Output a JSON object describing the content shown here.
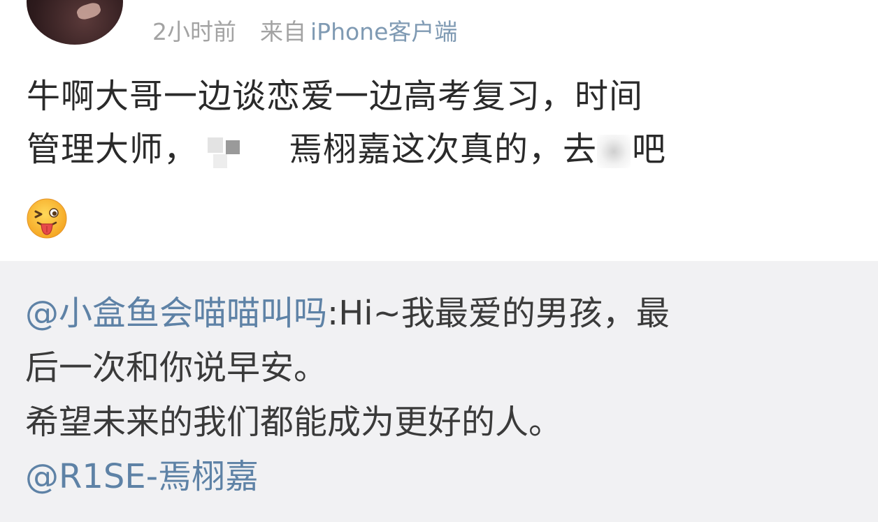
{
  "header": {
    "time": "2小时前",
    "source_prefix": "来自",
    "source_app": "iPhone客户端"
  },
  "post": {
    "line1": "牛啊大哥一边谈恋爱一边高考复习，时间",
    "line2_a": "管理大师，",
    "line2_b": "焉栩嘉这次真的，去",
    "line2_c": "吧",
    "emoji": "tongue-out-wink-emoji"
  },
  "quote": {
    "mention1": "@小盒鱼会喵喵叫吗",
    "line1_rest": ":Hi~我最爱的男孩，最",
    "line2": "后一次和你说早安。",
    "line3": "希望未来的我们都能成为更好的人。",
    "mention2": "@R1SE-焉栩嘉"
  },
  "colors": {
    "meta_gray": "#a3a3a3",
    "link_blue": "#5e82a6",
    "quote_bg": "#f1f1f3"
  }
}
